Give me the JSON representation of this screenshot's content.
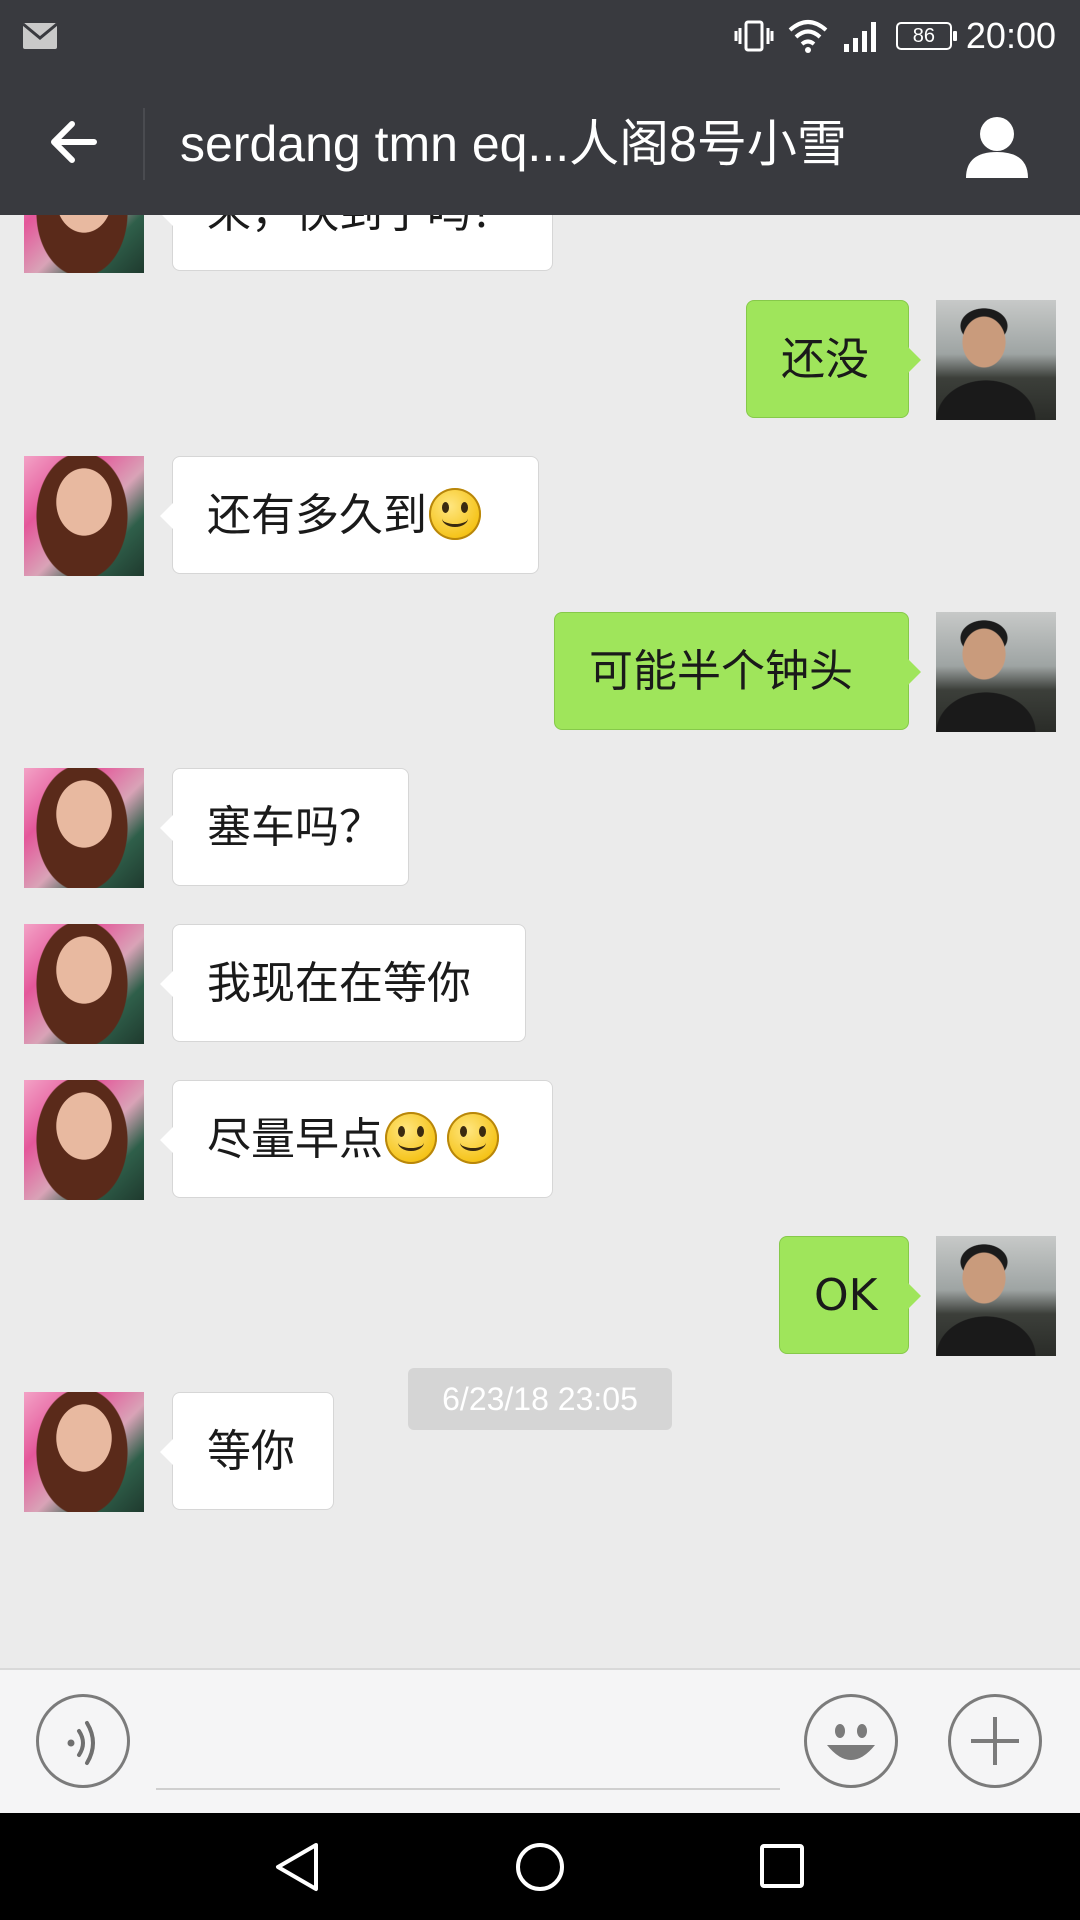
{
  "status_bar": {
    "icons": [
      "mail-icon",
      "vibrate-icon",
      "wifi-icon",
      "signal-icon"
    ],
    "battery": "86",
    "time": "20:00"
  },
  "header": {
    "title": "serdang tmn eq...人阁8号小雪",
    "back_icon": "arrow-left-icon",
    "profile_icon": "person-icon"
  },
  "messages": [
    {
      "side": "left",
      "text": "来，快到了吗？",
      "partial": true
    },
    {
      "side": "right",
      "text": "还没"
    },
    {
      "side": "left",
      "text": "还有多久到",
      "emoji": 1
    },
    {
      "side": "right",
      "text": "可能半个钟头"
    },
    {
      "side": "left",
      "text": "塞车吗？"
    },
    {
      "side": "left",
      "text": "我现在在等你"
    },
    {
      "side": "left",
      "text": "尽量早点",
      "emoji": 2
    },
    {
      "side": "right",
      "text": "OK"
    },
    {
      "side": "left",
      "text": "等你"
    }
  ],
  "timestamp": "6/23/18 23:05",
  "input_bar": {
    "voice_icon": "voice-icon",
    "emoji_icon": "emoji-icon",
    "plus_icon": "plus-icon",
    "input_value": ""
  },
  "nav_bar": [
    "back-triangle-icon",
    "home-circle-icon",
    "recents-square-icon"
  ],
  "colors": {
    "header_bg": "#393a3f",
    "chat_bg": "#ebebeb",
    "sent_bubble": "#9fe55b",
    "received_bubble": "#ffffff"
  }
}
